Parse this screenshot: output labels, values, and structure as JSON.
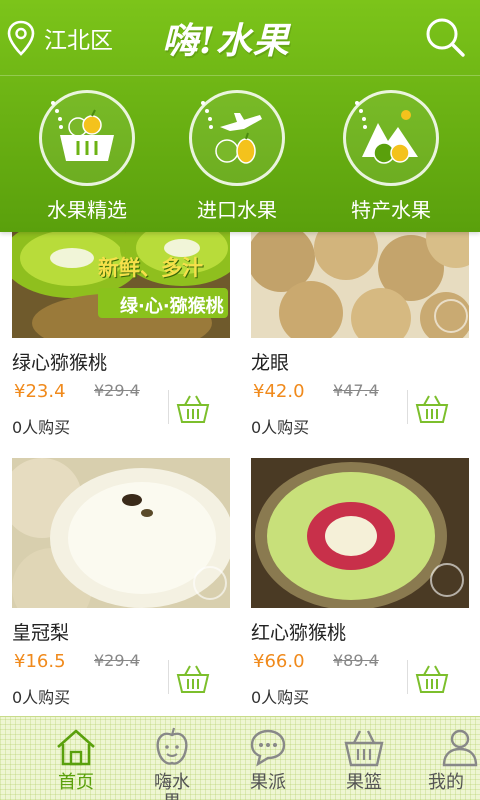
{
  "header": {
    "location": "江北区",
    "logo_text": "嗨!水果"
  },
  "categories": [
    {
      "label": "水果精选",
      "icon": "basket-fruit-icon"
    },
    {
      "label": "进口水果",
      "icon": "plane-fruit-icon"
    },
    {
      "label": "特产水果",
      "icon": "mountain-fruit-icon"
    }
  ],
  "products": [
    {
      "name": "绿心猕猴桃",
      "price": "¥23.4",
      "old_price": "¥29.4",
      "buyers": "0人购买",
      "banner_top": "新鲜、多汁",
      "banner_bottom": "绿·心·猕猴桃"
    },
    {
      "name": "龙眼",
      "price": "¥42.0",
      "old_price": "¥47.4",
      "buyers": "0人购买"
    },
    {
      "name": "皇冠梨",
      "price": "¥16.5",
      "old_price": "¥29.4",
      "buyers": "0人购买"
    },
    {
      "name": "红心猕猴桃",
      "price": "¥66.0",
      "old_price": "¥89.4",
      "buyers": "0人购买"
    }
  ],
  "tabs": [
    {
      "label": "首页",
      "active": true
    },
    {
      "label": "嗨水果",
      "active": false
    },
    {
      "label": "果派",
      "active": false
    },
    {
      "label": "果篮",
      "active": false
    },
    {
      "label": "我的",
      "active": false
    }
  ],
  "colors": {
    "brand_green": "#6cb314",
    "price_orange": "#f08a1c",
    "tab_active": "#5aa00c"
  }
}
